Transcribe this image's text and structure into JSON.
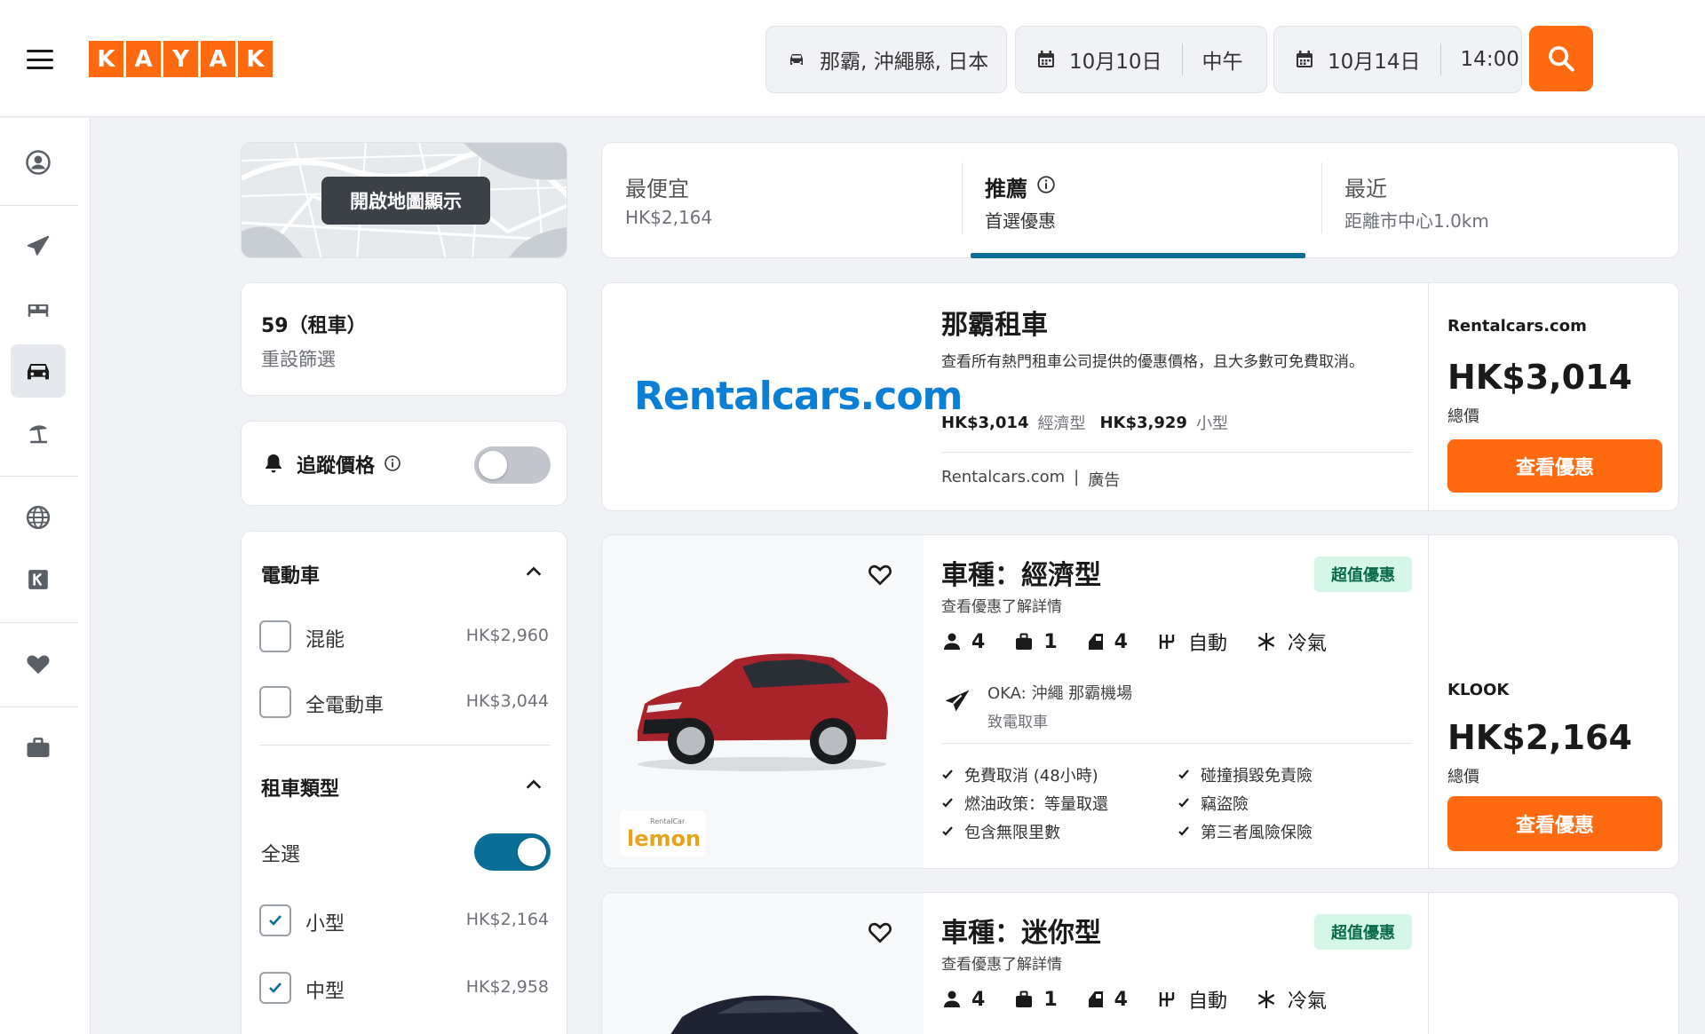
{
  "logo_letters": [
    "K",
    "A",
    "Y",
    "A",
    "K"
  ],
  "search": {
    "location": "那霸, 沖繩縣, 日本",
    "pickup_date": "10月10日",
    "pickup_time": "中午",
    "dropoff_date": "10月14日",
    "dropoff_time": "14:00"
  },
  "map": {
    "button_label": "開啟地圖顯示"
  },
  "results": {
    "count_label": "59（租車）",
    "reset_label": "重設篩選"
  },
  "price_alert": {
    "label": "追蹤價格",
    "enabled": false
  },
  "filters": {
    "ev": {
      "title": "電動車",
      "options": [
        {
          "label": "混能",
          "price": "HK$2,960",
          "checked": false
        },
        {
          "label": "全電動車",
          "price": "HK$3,044",
          "checked": false
        }
      ]
    },
    "car_type": {
      "title": "租車類型",
      "select_all_label": "全選",
      "select_all": true,
      "options": [
        {
          "label": "小型",
          "price": "HK$2,164",
          "checked": true
        },
        {
          "label": "中型",
          "price": "HK$2,958",
          "checked": true
        }
      ]
    }
  },
  "sort_tabs": [
    {
      "title": "最便宜",
      "sub": "HK$2,164",
      "active": false
    },
    {
      "title": "推薦",
      "sub": "首選優惠",
      "active": true
    },
    {
      "title": "最近",
      "sub": "距離市中心1.0km",
      "active": false
    }
  ],
  "ad": {
    "brand": "Rentalcars.com",
    "title": "那霸租車",
    "desc": "查看所有熱門租車公司提供的優惠價格，且大多數可免費取消。",
    "price_line_1": "HK$3,014",
    "price_line_1_type": "經濟型",
    "price_line_2": "HK$3,929",
    "price_line_2_type": "小型",
    "footer_source": "Rentalcars.com",
    "footer_tag": "廣告",
    "provider": "Rentalcars.com",
    "price": "HK$3,014",
    "price_note": "總價",
    "cta": "查看優惠"
  },
  "offers": [
    {
      "title": "車種：經濟型",
      "subtitle": "查看優惠了解詳情",
      "badge": "超值優惠",
      "passengers": "4",
      "bags": "1",
      "doors": "4",
      "transmission": "自動",
      "ac": "冷氣",
      "pickup_location": "OKA: 沖繩 那霸機場",
      "pickup_note": "致電取車",
      "features": [
        "免費取消 (48小時)",
        "燃油政策：等量取還",
        "包含無限里數",
        "碰撞損毀免責險",
        "竊盜險",
        "第三者風險保險"
      ],
      "supplier_logo_text": "lemon",
      "supplier_logo_sub": "RentalCar",
      "provider": "KLOOK",
      "price": "HK$2,164",
      "price_note": "總價",
      "cta": "查看優惠",
      "car_color": "#a8232a"
    },
    {
      "title": "車種：迷你型",
      "subtitle": "查看優惠了解詳情",
      "badge": "超值優惠",
      "passengers": "4",
      "bags": "1",
      "doors": "4",
      "transmission": "自動",
      "ac": "冷氣",
      "car_color": "#1e2233"
    }
  ],
  "colors": {
    "brand": "#ff690f",
    "accent": "#0b6e96",
    "deal_bg": "#d4f7e8"
  }
}
